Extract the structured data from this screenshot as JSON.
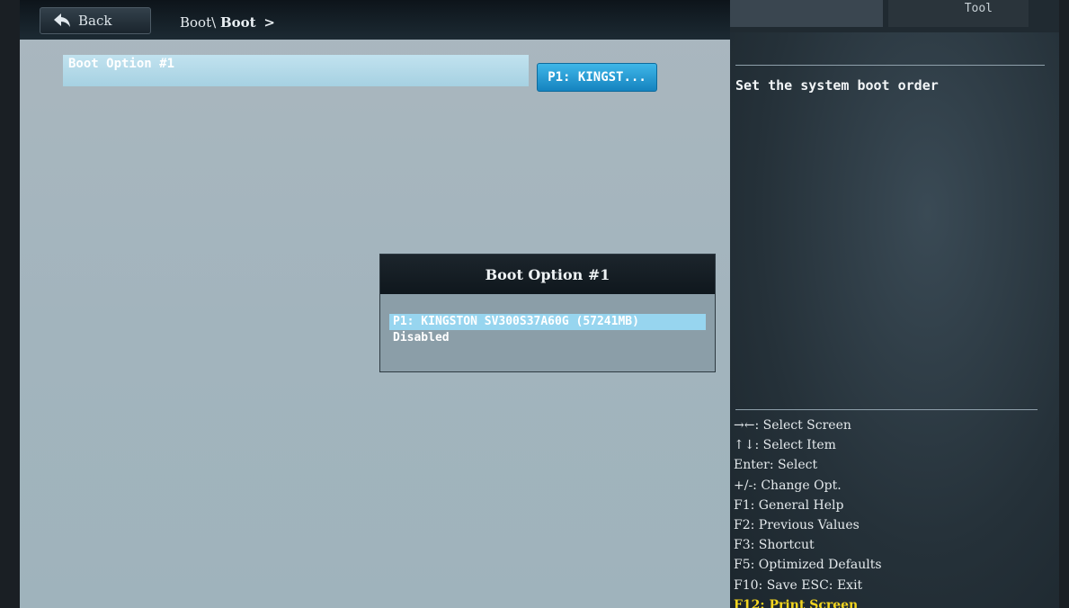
{
  "header": {
    "back_label": "Back",
    "breadcrumb_parent": "Boot\\",
    "breadcrumb_current": "Boot",
    "breadcrumb_sep": ">"
  },
  "right_tabs": {
    "tab2_label": "Tool"
  },
  "settings": {
    "option_label": "Boot Option #1",
    "option_value": "P1: KINGST..."
  },
  "help": {
    "description": "Set the system boot order",
    "keys": [
      "→←: Select Screen",
      "↑↓: Select Item",
      "Enter: Select",
      "+/-: Change Opt.",
      "F1: General Help",
      "F2: Previous Values",
      "F3: Shortcut",
      "F5: Optimized Defaults",
      "F10: Save  ESC: Exit",
      "F12: Print Screen"
    ]
  },
  "popup": {
    "title": "Boot Option #1",
    "options": [
      "P1: KINGSTON SV300S37A60G  (57241MB)",
      "Disabled"
    ],
    "selected_index": 0
  },
  "colors": {
    "accent": "#1583bf",
    "highlight": "#f3d51f",
    "selection": "#97d5ef"
  }
}
